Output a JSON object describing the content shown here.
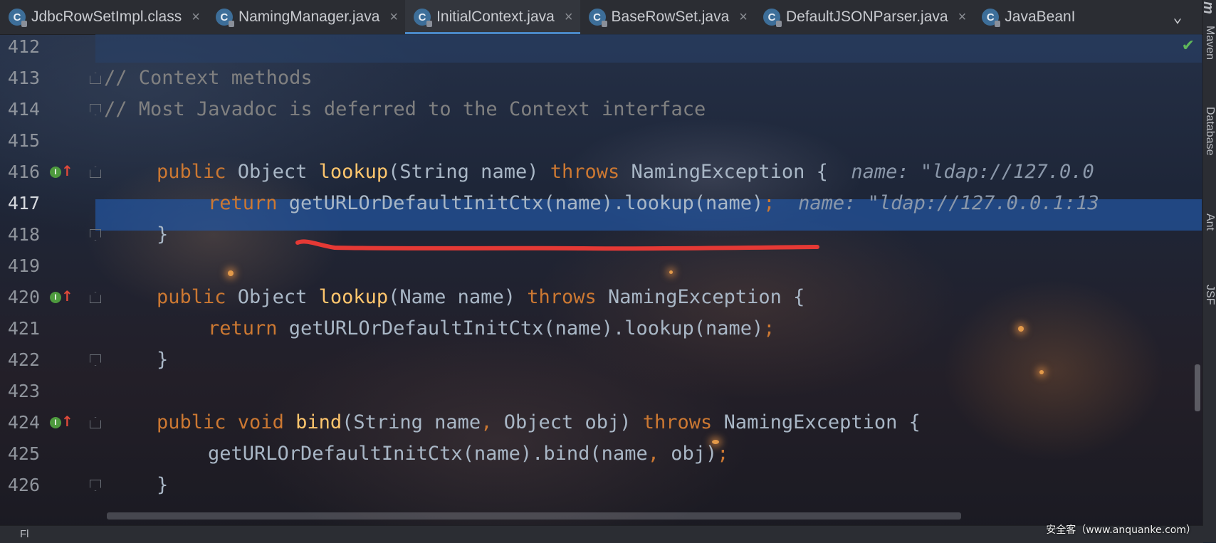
{
  "tabs": [
    {
      "label": "JdbcRowSetImpl.class",
      "icon": "class-icon",
      "active": false
    },
    {
      "label": "NamingManager.java",
      "icon": "class-icon",
      "active": false
    },
    {
      "label": "InitialContext.java",
      "icon": "class-icon",
      "active": true
    },
    {
      "label": "BaseRowSet.java",
      "icon": "class-icon",
      "active": false
    },
    {
      "label": "DefaultJSONParser.java",
      "icon": "class-icon",
      "active": false
    },
    {
      "label": "JavaBeanI",
      "icon": "class-icon",
      "active": false
    }
  ],
  "tab_icon_letter": "C",
  "close_glyph": "×",
  "tab_menu_glyph": "⌄",
  "right_sidebar": [
    "m",
    "Maven",
    "Database",
    "Ant",
    "JSF"
  ],
  "lines": [
    {
      "num": "412"
    },
    {
      "num": "413",
      "comment": "// Context methods"
    },
    {
      "num": "414",
      "comment": "// Most Javadoc is deferred to the Context interface"
    },
    {
      "num": "415"
    },
    {
      "num": "416",
      "t1": "public ",
      "t2": "Object ",
      "t3": "lookup",
      "t4": "(String name) ",
      "t5": "throws ",
      "t6": "NamingException {",
      "hint": "name: \"ldap://127.0.0"
    },
    {
      "num": "417",
      "t1": "return ",
      "t2": "getURLOrDefaultInitCtx(name).lookup(name)",
      "t3": ";",
      "hint": "name: \"ldap://127.0.0.1:13"
    },
    {
      "num": "418",
      "text": "}"
    },
    {
      "num": "419"
    },
    {
      "num": "420",
      "t1": "public ",
      "t2": "Object ",
      "t3": "lookup",
      "t4": "(Name name) ",
      "t5": "throws ",
      "t6": "NamingException {"
    },
    {
      "num": "421",
      "t1": "return ",
      "t2": "getURLOrDefaultInitCtx(name).lookup(name)",
      "t3": ";"
    },
    {
      "num": "422",
      "text": "}"
    },
    {
      "num": "423"
    },
    {
      "num": "424",
      "t1": "public ",
      "t2": "void ",
      "t3": "bind",
      "t4": "(String name",
      "t5": ", ",
      "t6": "Object obj) ",
      "t7": "throws ",
      "t8": "NamingException {"
    },
    {
      "num": "425",
      "t2": "getURLOrDefaultInitCtx(name).bind(name",
      "t3": ", ",
      "t4": "obj)",
      "t5": ";"
    },
    {
      "num": "426",
      "text": "}"
    }
  ],
  "gutter_marker": "I",
  "gutter_arrow": "↑",
  "checkmark": "✔",
  "bottom_partial": "Fl",
  "watermark": "安全客（www.anquanke.com）",
  "colors": {
    "keyword": "#cc7832",
    "function": "#ffc66d",
    "comment": "#808080",
    "selection": "#2355a0",
    "annotation": "#e53935"
  }
}
